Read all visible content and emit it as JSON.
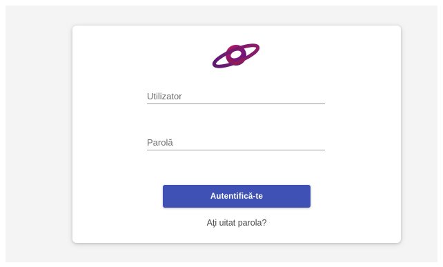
{
  "login": {
    "logo_icon": "planet-logo-icon",
    "username": {
      "value": "",
      "placeholder": "Utilizator"
    },
    "password": {
      "value": "",
      "placeholder": "Parolă"
    },
    "submit_label": "Autentifică-te",
    "forgot_password_label": "Aţi uitat parola?"
  },
  "colors": {
    "primary": "#3f51b5",
    "logo_purple": "#6a1b6e",
    "logo_magenta": "#c2185b",
    "background": "#f4f4f4",
    "card": "#ffffff"
  }
}
